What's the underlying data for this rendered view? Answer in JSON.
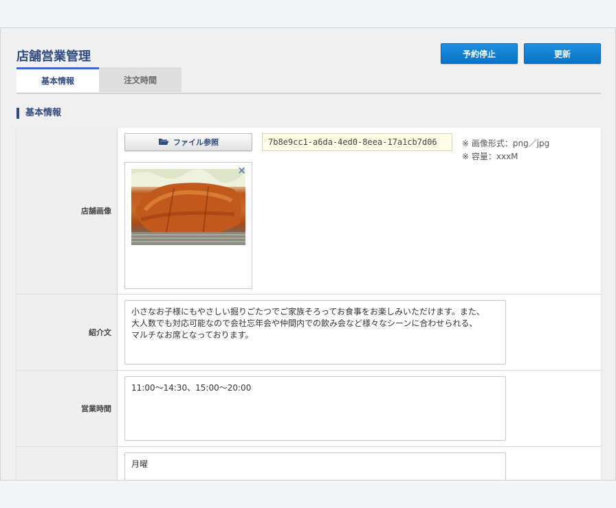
{
  "header": {
    "title": "店舗営業管理",
    "buttons": {
      "suspend": "予約停止",
      "update": "更新"
    }
  },
  "tabs": [
    {
      "label": "基本情報",
      "active": true
    },
    {
      "label": "注文時間",
      "active": false
    }
  ],
  "section": {
    "title": "基本情報"
  },
  "form": {
    "image": {
      "label": "店舗画像",
      "button": "ファイル参照",
      "filename": "7b8e9cc1-a6da-4ed0-8eea-17a1cb7d06",
      "notes": [
        "※ 画像形式：png／jpg",
        "※ 容量：xxxM"
      ],
      "close": "×"
    },
    "intro": {
      "label": "紹介文",
      "value": "小さなお子様にもやさしい掘りごたつでご家族そろってお食事をお楽しみいただけます。また、\n大人数でも対応可能なので会社忘年会や仲間内での飲み会など様々なシーンに合わせられる、\nマルチなお席となっております。"
    },
    "hours": {
      "label": "営業時間",
      "value": "11:00〜14:30、15:00〜20:00"
    },
    "holiday": {
      "label": "",
      "value": "月曜"
    }
  },
  "colors": {
    "accent": "#2f4a7e",
    "button": "#0a72c4"
  }
}
